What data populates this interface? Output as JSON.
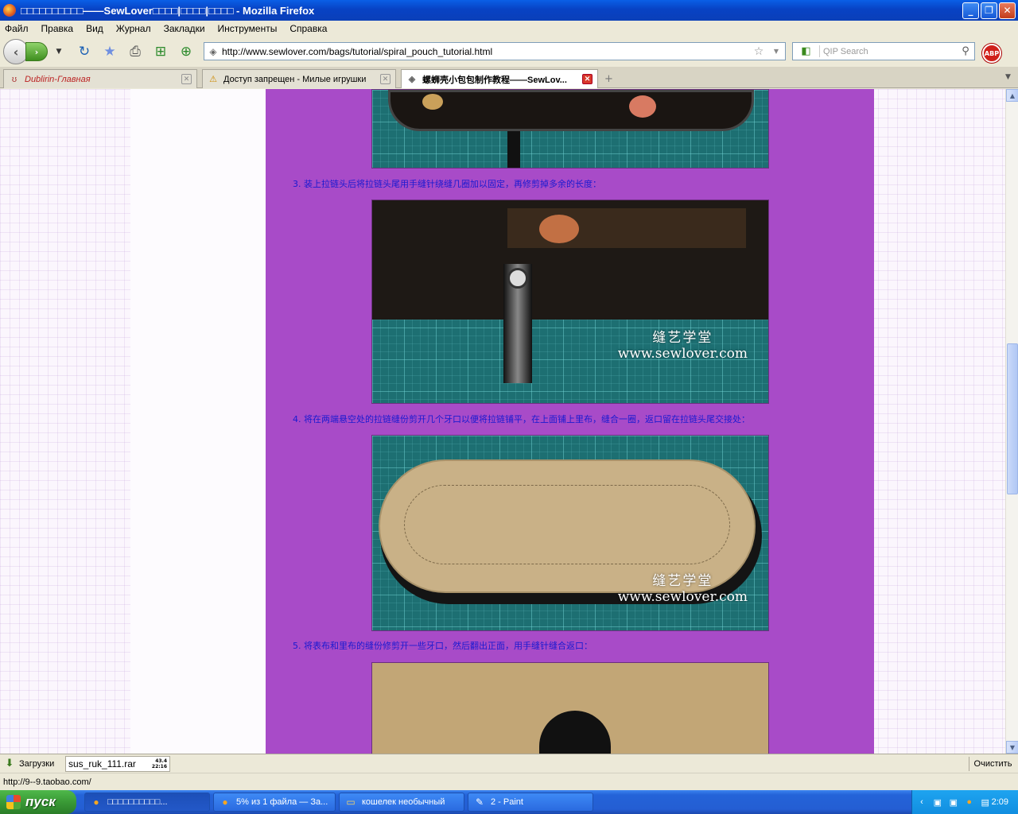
{
  "window": {
    "title": "□□□□□□□□□□——SewLover□□□□|□□□□|□□□□ - Mozilla Firefox",
    "minimize": "_",
    "maximize": "❐",
    "close": "✕"
  },
  "menu": [
    "Файл",
    "Правка",
    "Вид",
    "Журнал",
    "Закладки",
    "Инструменты",
    "Справка"
  ],
  "toolbar": {
    "url": "http://www.sewlover.com/bags/tutorial/spiral_pouch_tutorial.html",
    "search_placeholder": "QIP Search",
    "abp_label": "ABP"
  },
  "tabs": [
    {
      "label": "Dublirin-Главная",
      "active": false
    },
    {
      "label": "Доступ запрещен - Милые игрушки",
      "active": false
    },
    {
      "label": "螺蛳壳小包包制作教程——SewLov...",
      "active": true
    }
  ],
  "page": {
    "captions": [
      "3. 装上拉链头后将拉链头尾用手缝针绕缝几圈加以固定，再修剪掉多余的长度：",
      "4. 将在两端悬空处的拉链缝份剪开几个牙口以便将拉链铺平，在上面铺上里布，缝合一圈，返口留在拉链头尾交接处：",
      "5. 将表布和里布的缝份修剪开一些牙口，然后翻出正面，用手缝针缝合返口："
    ],
    "watermark_cn": "缝艺学堂",
    "watermark_web": "www.sewlover.com"
  },
  "downloads": {
    "title": "Загрузки",
    "item_name": "sus_ruk_111.rar",
    "item_stat1": "43.4",
    "item_stat2": "22:16",
    "clear_label": "Очистить"
  },
  "status": {
    "text": "http://9--9.taobao.com/"
  },
  "taskbar": {
    "start_label": "пуск",
    "tasks": [
      {
        "label": "□□□□□□□□□□..."
      },
      {
        "label": "5% из 1 файла — За..."
      },
      {
        "label": "кошелек необычный"
      },
      {
        "label": "2 - Paint"
      }
    ],
    "clock": "2:09"
  }
}
